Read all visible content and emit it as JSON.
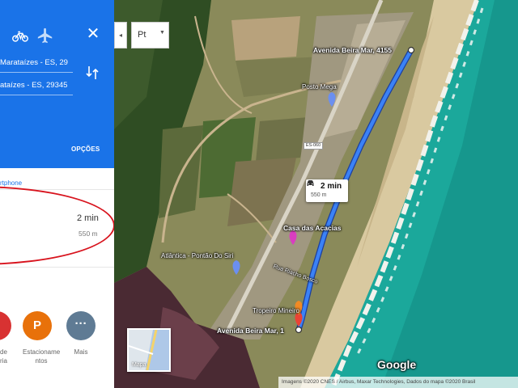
{
  "directions_panel": {
    "origin": "Marataízes - ES, 29",
    "destination": "ataízes - ES, 29345",
    "options_label": "OPÇÕES",
    "trip_link": "rtphone",
    "route": {
      "duration": "2 min",
      "distance": "550 m"
    },
    "categories": [
      {
        "label": "de\nria",
        "icon": "restaurant-icon"
      },
      {
        "label": "Estacioname\nntos",
        "icon": "P"
      },
      {
        "label": "Mais",
        "icon": "···"
      }
    ],
    "colors": {
      "header": "#1a73e8",
      "highlight_ellipse": "#d8141e",
      "route": "#3367d6"
    }
  },
  "map": {
    "language_select": "Pt",
    "labels": {
      "start_address": "Avenida Beira Mar, 4155",
      "end_address": "Avenida Beira Mar, 1",
      "posto": "Posto Mega",
      "casa": "Casa das Acacias",
      "atlantica": "Atlântica - Pontão Do Siri",
      "street": "Rua Riacho Bosco",
      "tropeiro": "Tropeiro Mineiro",
      "road_badge": "ES-060",
      "brand": "Google"
    },
    "route_card": {
      "time": "2 min",
      "distance": "550 m"
    },
    "layers_label": "Mapa",
    "attribution": "Imagens ©2020 CNES / Airbus, Maxar Technologies, Dados do mapa ©2020   Brasil"
  }
}
